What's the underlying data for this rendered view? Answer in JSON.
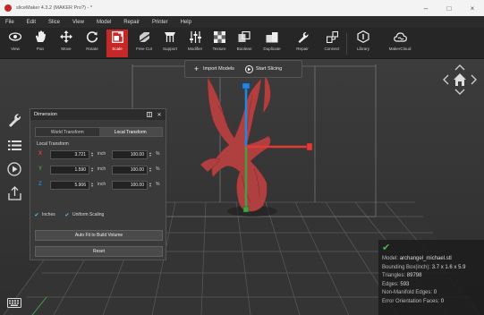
{
  "window": {
    "title": "sliceMaker 4.3.2 (MAKER Pro?) - *",
    "minimize": "–",
    "maximize": "□",
    "close": "×"
  },
  "menu": [
    "File",
    "Edit",
    "Slice",
    "View",
    "Model",
    "Repair",
    "Printer",
    "Help"
  ],
  "toolbar": {
    "view": "View",
    "pan": "Pan",
    "move": "Move",
    "rotate": "Rotate",
    "scale": "Scale",
    "free_cut": "Free Cut",
    "support": "Support",
    "modifier": "Modifier",
    "texture": "Texture",
    "boolean": "Boolean",
    "duplicate": "Duplicate",
    "repair": "Repair",
    "connect": "Connect",
    "library": "Library",
    "makercloud": "MakerCloud"
  },
  "actions": {
    "import": "Import Models",
    "slice": "Start Slicing"
  },
  "panel": {
    "title": "Dimension",
    "tab_world": "World Transform",
    "tab_local": "Local Transform",
    "group": "Local Transform",
    "rows": [
      {
        "axis": "X",
        "value": "3.721",
        "unit": "inch",
        "percent": "100.00",
        "pct": "%",
        "color": "#e53935"
      },
      {
        "axis": "Y",
        "value": "1.590",
        "unit": "inch",
        "percent": "100.00",
        "pct": "%",
        "color": "#43a047"
      },
      {
        "axis": "Z",
        "value": "5.906",
        "unit": "inch",
        "percent": "100.00",
        "pct": "%",
        "color": "#1e88e5"
      }
    ],
    "inches": "Inches",
    "uniform": "Uniform Scaling",
    "autofit": "Auto Fit to Build Volume",
    "reset": "Reset"
  },
  "info": {
    "model_label": "Model:",
    "model": "archangel_michael.stl",
    "bbox_label": "Bounding Box(inch):",
    "bbox": "3.7 x 1.6 x 5.9",
    "tri_label": "Triangles:",
    "tri": "89798",
    "edges_label": "Edges:",
    "edges": "593",
    "nonman_label": "Non-Manifold Edges:",
    "nonman": "0",
    "err_label": "Error Orientation Faces:",
    "err": "0"
  },
  "colors": {
    "accent": "#c62828",
    "model": "#b04040",
    "ok": "#4caf50"
  }
}
